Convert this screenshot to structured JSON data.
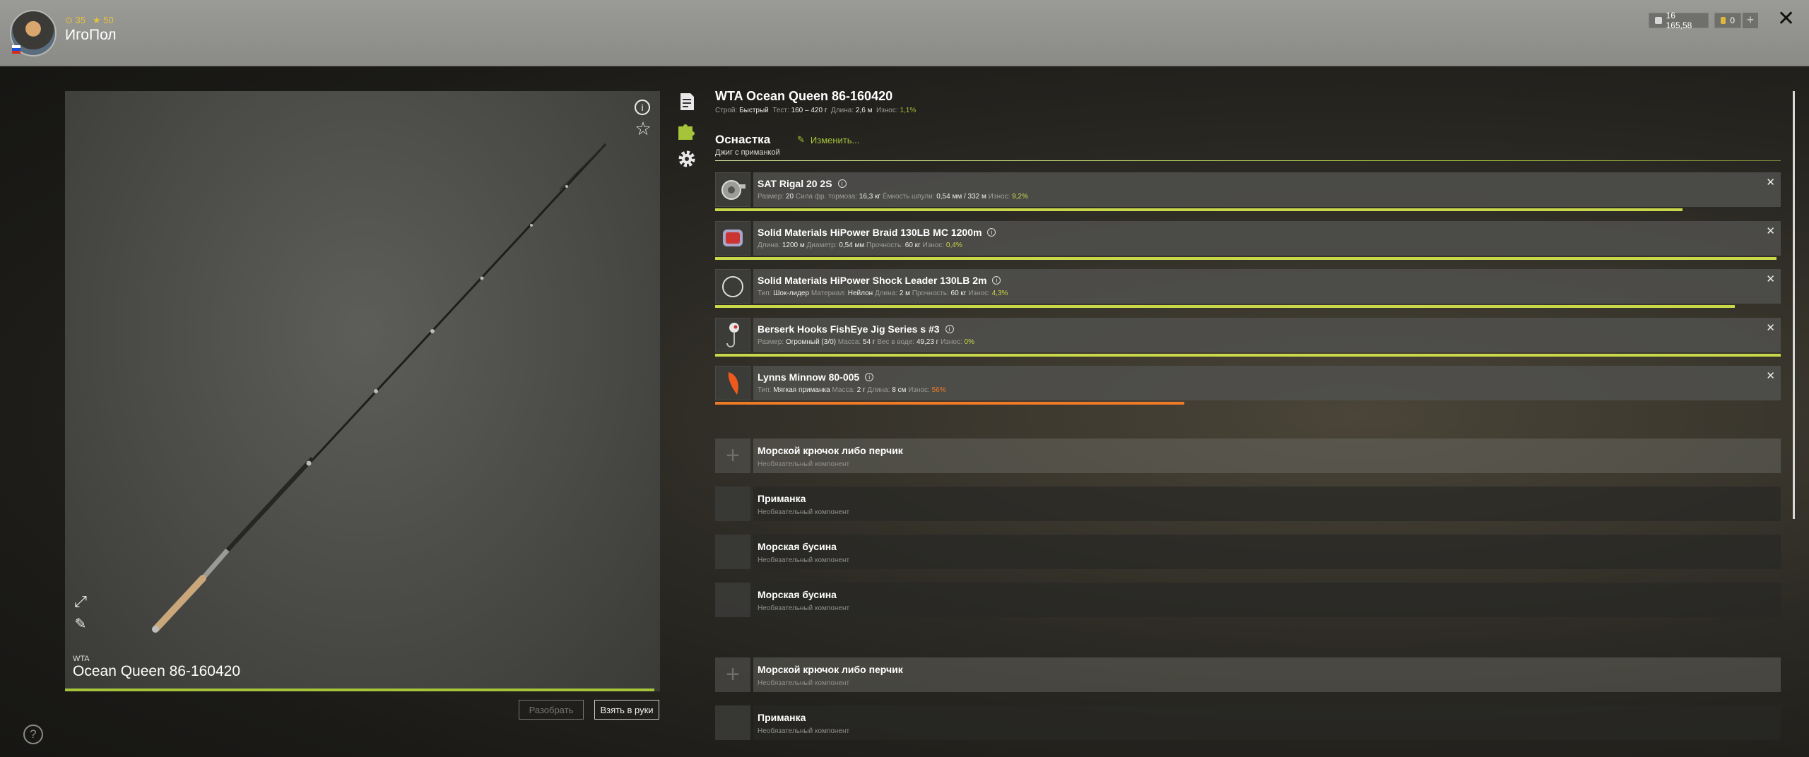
{
  "header": {
    "stats": {
      "level": "35",
      "rank": "50"
    },
    "username": "ИгоПол",
    "silver": "16 165,58",
    "gold": "0",
    "plus_label": "+",
    "close_label": "✕"
  },
  "rod": {
    "brand": "WTA",
    "name": "Ocean Queen 86-160420",
    "wear_fraction": 0.99
  },
  "buttons": {
    "disassemble": "Разобрать",
    "take": "Взять в руки"
  },
  "details": {
    "title": "WTA Ocean Queen 86-160420",
    "specs": {
      "action_label": "Строй:",
      "action": "Быстрый",
      "test_label": "Тест:",
      "test": "160 – 420 г",
      "length_label": "Длина:",
      "length": "2,6 м",
      "wear_label": "Износ:",
      "wear": "1,1%"
    },
    "section_title": "Оснастка",
    "edit_label": "Изменить...",
    "rig_type": "Джиг с приманкой"
  },
  "items": [
    {
      "name": "SAT Rigal 20 2S",
      "meta": [
        {
          "k": "Размер:",
          "v": "20"
        },
        {
          "k": "Сила фр. тормоза:",
          "v": "16,3 кг"
        },
        {
          "k": "Ёмкость шпули:",
          "v": "0,54 мм / 332 м"
        },
        {
          "k": "Износ:",
          "v": "9,2%",
          "c": "g"
        }
      ],
      "condition": 0.908,
      "bar_color": "#c9d84a",
      "thumb": "reel"
    },
    {
      "name": "Solid Materials HiPower Braid 130LB MC 1200m",
      "meta": [
        {
          "k": "Длина:",
          "v": "1200 м"
        },
        {
          "k": "Диаметр:",
          "v": "0,54 мм"
        },
        {
          "k": "Прочность:",
          "v": "60 кг"
        },
        {
          "k": "Износ:",
          "v": "0,4%",
          "c": "g"
        }
      ],
      "condition": 0.996,
      "bar_color": "#c9d84a",
      "thumb": "line"
    },
    {
      "name": "Solid Materials HiPower Shock Leader 130LB 2m",
      "meta": [
        {
          "k": "Тип:",
          "v": "Шок-лидер"
        },
        {
          "k": "Материал:",
          "v": "Нейлон"
        },
        {
          "k": "Длина:",
          "v": "2 м"
        },
        {
          "k": "Прочность:",
          "v": "60 кг"
        },
        {
          "k": "Износ:",
          "v": "4,3%",
          "c": "g"
        }
      ],
      "condition": 0.957,
      "bar_color": "#c9d84a",
      "thumb": "leader"
    },
    {
      "name": "Berserk Hooks FishEye Jig Series s #3",
      "meta": [
        {
          "k": "Размер:",
          "v": "Огромный (3/0)"
        },
        {
          "k": "Масса:",
          "v": "54 г"
        },
        {
          "k": "Вес в воде:",
          "v": "49,23 г"
        },
        {
          "k": "Износ:",
          "v": "0%",
          "c": "g"
        }
      ],
      "condition": 1.0,
      "bar_color": "#c9d84a",
      "thumb": "jig"
    },
    {
      "name": "Lynns Minnow 80-005",
      "meta": [
        {
          "k": "Тип:",
          "v": "Мягкая приманка"
        },
        {
          "k": "Масса:",
          "v": "2 г"
        },
        {
          "k": "Длина:",
          "v": "8 см"
        },
        {
          "k": "Износ:",
          "v": "56%",
          "c": "o"
        }
      ],
      "condition": 0.44,
      "bar_color": "#f07a28",
      "thumb": "bait"
    }
  ],
  "slots": [
    {
      "name": "Морской крючок либо перчик",
      "desc": "Необязательный компонент",
      "light": true,
      "plus": true
    },
    {
      "name": "Приманка",
      "desc": "Необязательный компонент",
      "light": false,
      "plus": false
    },
    {
      "name": "Морская бусина",
      "desc": "Необязательный компонент",
      "light": false,
      "plus": false
    },
    {
      "name": "Морская бусина",
      "desc": "Необязательный компонент",
      "light": false,
      "plus": false
    },
    {
      "name": "Морской крючок либо перчик",
      "desc": "Необязательный компонент",
      "light": true,
      "plus": true
    },
    {
      "name": "Приманка",
      "desc": "Необязательный компонент",
      "light": false,
      "plus": false
    }
  ],
  "icons": {
    "info": "info-icon",
    "favorite": "star-icon",
    "expand": "expand-icon",
    "paint": "brush-icon",
    "help": "help-icon",
    "description_tab": "document-icon",
    "rig_tab": "puzzle-icon",
    "settings_tab": "gear-icon"
  },
  "colors": {
    "accent": "#a5c43a",
    "wear_warning": "#f07a28"
  }
}
